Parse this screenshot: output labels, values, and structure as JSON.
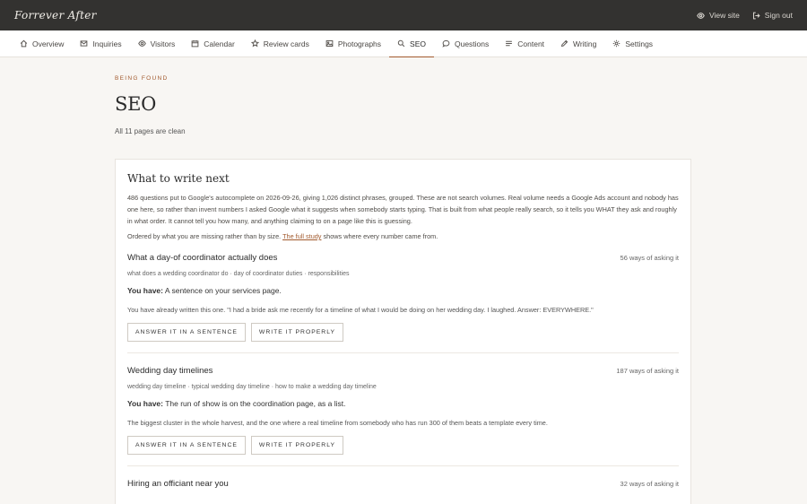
{
  "brand": "Forrever After",
  "top_actions": [
    {
      "label": "View site",
      "icon": "eye-icon"
    },
    {
      "label": "Sign out",
      "icon": "sign-out-icon"
    }
  ],
  "nav": [
    {
      "label": "Overview",
      "icon": "home-icon"
    },
    {
      "label": "Inquiries",
      "icon": "mail-icon"
    },
    {
      "label": "Visitors",
      "icon": "eye-icon"
    },
    {
      "label": "Calendar",
      "icon": "calendar-icon"
    },
    {
      "label": "Review cards",
      "icon": "star-icon"
    },
    {
      "label": "Photographs",
      "icon": "image-icon"
    },
    {
      "label": "SEO",
      "icon": "search-icon",
      "active": true
    },
    {
      "label": "Questions",
      "icon": "chat-icon"
    },
    {
      "label": "Content",
      "icon": "lines-icon"
    },
    {
      "label": "Writing",
      "icon": "pen-icon"
    },
    {
      "label": "Settings",
      "icon": "gear-icon"
    }
  ],
  "header": {
    "eyebrow": "Being found",
    "title": "SEO",
    "subtitle": "All 11 pages are clean"
  },
  "card": {
    "title": "What to write next",
    "intro": "486 questions put to Google's autocomplete on 2026-09-26, giving 1,026 distinct phrases, grouped. These are not search volumes. Real volume needs a Google Ads account and nobody has one here, so rather than invent numbers I asked Google what it suggests when somebody starts typing. That is built from what people really search, so it tells you WHAT they ask and roughly in what order. It cannot tell you how many, and anything claiming to on a page like this is guessing.",
    "ordered_pre": "Ordered by what you are missing rather than by size.",
    "study_link": "The full study",
    "ordered_post": "shows where every number came from.",
    "have_label": "You have:",
    "btn_answer": "Answer it in a sentence",
    "btn_write": "Write it properly",
    "topics": [
      {
        "title": "What a day-of coordinator actually does",
        "count": "56 ways of asking it",
        "phrases": "what does a wedding coordinator do · day of coordinator duties · responsibilities",
        "have": "A sentence on your services page.",
        "note": "You have already written this one. \"I had a bride ask me recently for a timeline of what I would be doing on her wedding day. I laughed. Answer: EVERYWHERE.\""
      },
      {
        "title": "Wedding day timelines",
        "count": "187 ways of asking it",
        "phrases": "wedding day timeline · typical wedding day timeline · how to make a wedding day timeline",
        "have": "The run of show is on the coordination page, as a list.",
        "note": "The biggest cluster in the whole harvest, and the one where a real timeline from somebody who has run 300 of them beats a template every time."
      },
      {
        "title": "Hiring an officiant near you",
        "count": "32 ways of asking it"
      }
    ]
  }
}
